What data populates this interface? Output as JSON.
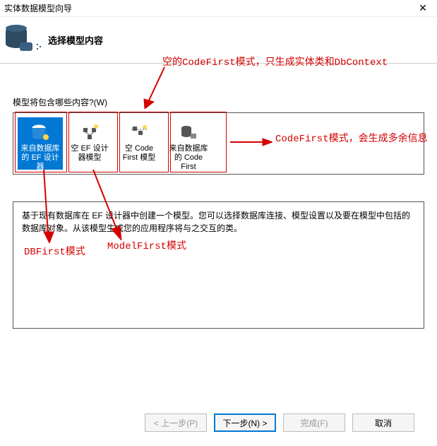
{
  "title": "实体数据模型向导",
  "header": "选择模型内容",
  "label": "模型将包含哪些内容?(W)",
  "options": [
    {
      "label": "来自数据库的 EF 设计器"
    },
    {
      "label": "空 EF 设计器模型"
    },
    {
      "label": "空 Code First 模型"
    },
    {
      "label": "来自数据库的 Code First"
    }
  ],
  "description": "基于现有数据库在 EF 设计器中创建一个模型。您可以选择数据库连接、模型设置以及要在模型中包括的数据库对象。从该模型生成您的应用程序将与之交互的类。",
  "buttons": {
    "prev": "< 上一步(P)",
    "next": "下一步(N) >",
    "finish": "完成(F)",
    "cancel": "取消"
  },
  "annotations": {
    "empty_codefirst": "空的CodeFirst模式，只生成实体类和DbContext",
    "codefirst_db": "CodeFirst模式，会生成多余信息",
    "dbfirst": "DBFirst模式",
    "modelfirst": "ModelFirst模式"
  }
}
